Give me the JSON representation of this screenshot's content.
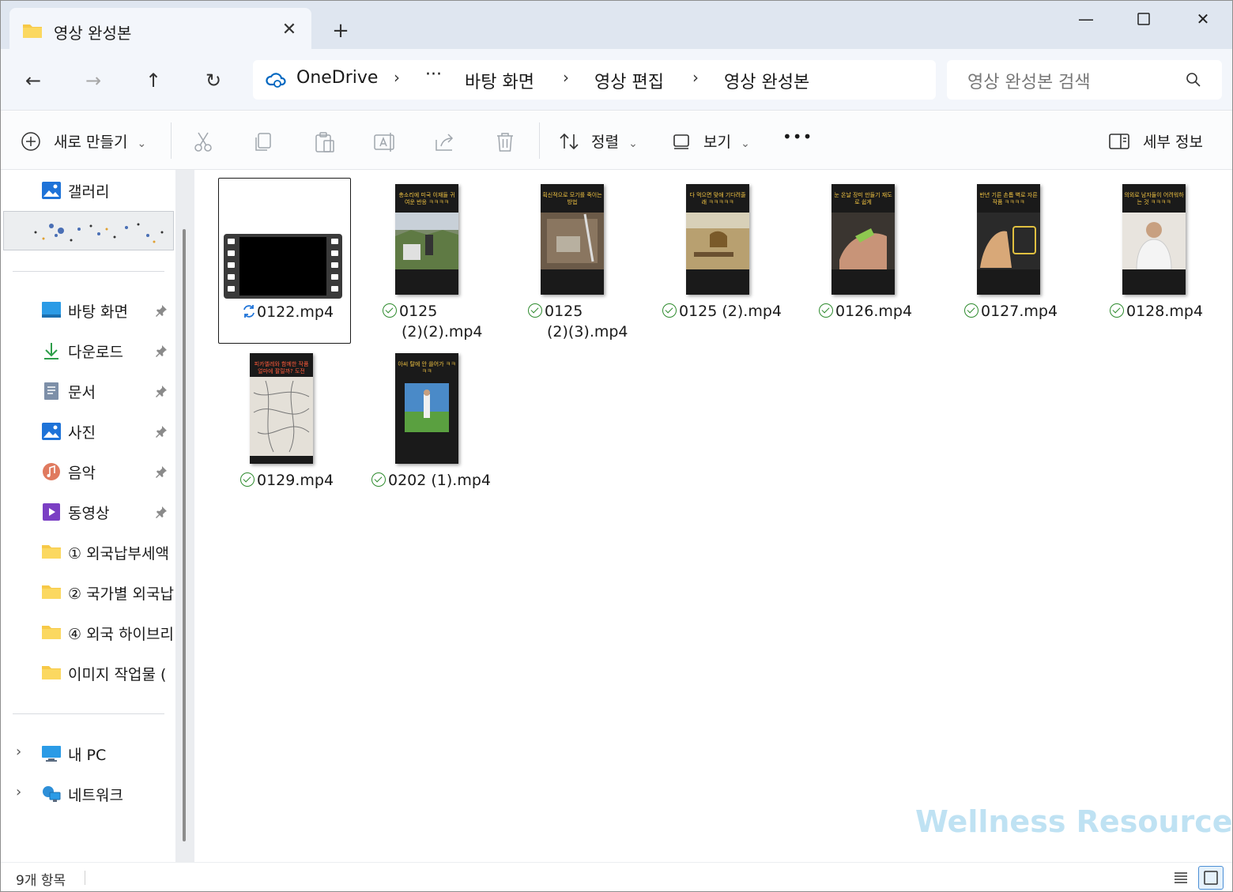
{
  "window": {
    "tab_title": "영상 완성본",
    "close_tab": "✕",
    "new_tab": "+",
    "minimize": "—",
    "maximize": "☐",
    "close": "✕"
  },
  "nav": {
    "back": "←",
    "forward": "→",
    "up": "↑",
    "refresh": "↻"
  },
  "breadcrumbs": {
    "root": "OneDrive",
    "ellipsis": "···",
    "items": [
      "바탕 화면",
      "영상 편집",
      "영상 완성본"
    ],
    "separator": "›"
  },
  "search": {
    "placeholder": "영상 완성본 검색"
  },
  "toolbar": {
    "new_label": "새로 만들기",
    "sort_label": "정렬",
    "view_label": "보기",
    "more_label": "•••",
    "details_label": "세부 정보",
    "chevron": "⌄"
  },
  "sidebar": {
    "gallery": "갤러리",
    "quick_access": [
      {
        "label": "바탕 화면",
        "icon": "desktop-icon",
        "pinned": true
      },
      {
        "label": "다운로드",
        "icon": "download-icon",
        "pinned": true
      },
      {
        "label": "문서",
        "icon": "document-icon",
        "pinned": true
      },
      {
        "label": "사진",
        "icon": "pictures-icon",
        "pinned": true
      },
      {
        "label": "음악",
        "icon": "music-icon",
        "pinned": true
      },
      {
        "label": "동영상",
        "icon": "videos-icon",
        "pinned": true
      },
      {
        "label": "① 외국납부세액",
        "icon": "folder-icon",
        "pinned": false
      },
      {
        "label": "② 국가별 외국납",
        "icon": "folder-icon",
        "pinned": false
      },
      {
        "label": "④ 외국 하이브리",
        "icon": "folder-icon",
        "pinned": false
      },
      {
        "label": "이미지 작업물 (",
        "icon": "folder-icon",
        "pinned": false
      }
    ],
    "this_pc": "내 PC",
    "network": "네트워크",
    "expand_chevron": "›",
    "pin_glyph": "📌"
  },
  "files": [
    {
      "name": "0122.mp4",
      "status": "syncing",
      "selected": true,
      "caption": ""
    },
    {
      "name_line1": "0125",
      "name_line2": "(2)(2).mp4",
      "status": "synced",
      "caption": "총소리에 미국 이재들 귀여운 반응 ㅋㅋㅋㅋ",
      "scene": "outdoor"
    },
    {
      "name_line1": "0125",
      "name_line2": "(2)(3).mp4",
      "status": "synced",
      "caption": "획신적으로 모기를 죽이는 방법",
      "scene": "box"
    },
    {
      "name": "0125 (2).mp4",
      "status": "synced",
      "caption": "다 먹으면 맞애 기다려줄래 ㅋㅋㅋㅋㅋ",
      "scene": "savanna"
    },
    {
      "name": "0126.mp4",
      "status": "synced",
      "caption": "눈 온날 장미 만들기 재도로 쉽게",
      "scene": "hand"
    },
    {
      "name": "0127.mp4",
      "status": "synced",
      "caption": "반년 기른 손톱 벽로 자른 작품 ㅋㅋㅋㅋ",
      "scene": "nails"
    },
    {
      "name": "0128.mp4",
      "status": "synced",
      "caption": "의외로 남자들이 어려워하는 것 ㅋㅋㅋㅋ",
      "scene": "person"
    },
    {
      "name": "0129.mp4",
      "status": "synced",
      "caption": "피카엘레와 함께한 작품 얼마에 팔릴까? 도전",
      "scene": "art"
    },
    {
      "name": "0202 (1).mp4",
      "status": "synced",
      "caption": "아씨 탈에 안 쓸어가 ㅋㅋㅋㅋ",
      "scene": "golf"
    }
  ],
  "status_bar": {
    "count": "9개 항목"
  },
  "watermark": "Wellness Resources",
  "colors": {
    "accent": "#0067c0",
    "sync_ok": "#2e8b2e",
    "caption_yellow": "#f4c542",
    "folder": "#f7c948"
  }
}
